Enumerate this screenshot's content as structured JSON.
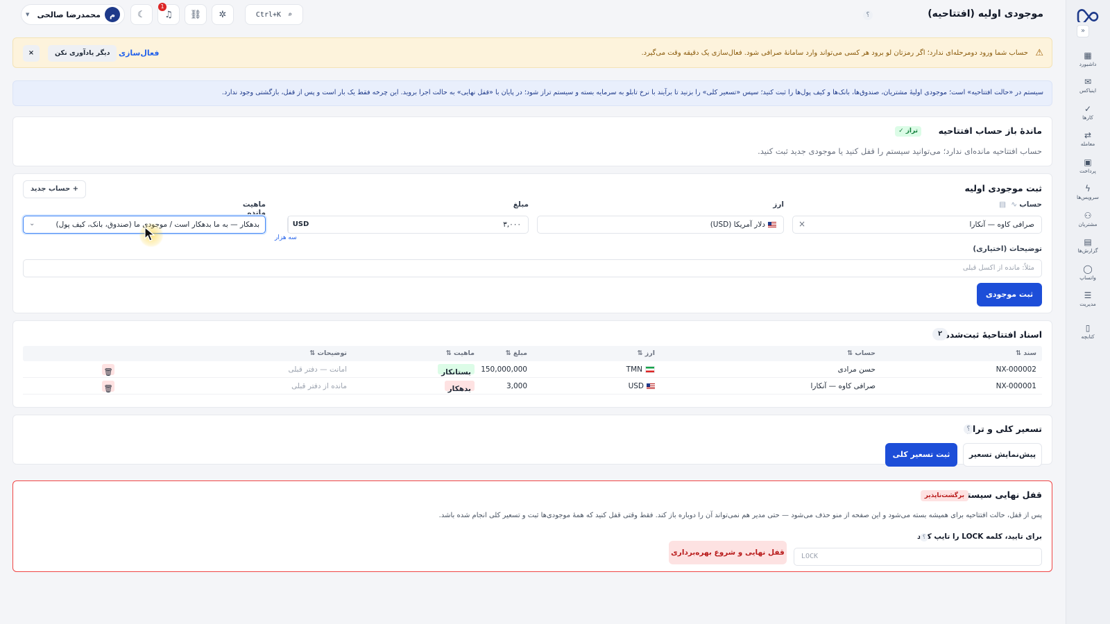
{
  "sidebar": {
    "collapse": "«",
    "items": [
      {
        "label": "داشبورد",
        "icon": "dashboard-icon",
        "glyph": "▦"
      },
      {
        "label": "اینباکس",
        "icon": "inbox-icon",
        "glyph": "✉"
      },
      {
        "label": "کارها",
        "icon": "tasks-icon",
        "glyph": "✓"
      },
      {
        "label": "معامله",
        "icon": "trade-icon",
        "glyph": "⇄"
      },
      {
        "label": "پرداخت",
        "icon": "payment-icon",
        "glyph": "▣"
      },
      {
        "label": "سرویس‌ها",
        "icon": "services-icon",
        "glyph": "ϟ"
      },
      {
        "label": "مشتریان",
        "icon": "customers-icon",
        "glyph": "⚇"
      },
      {
        "label": "گزارش‌ها",
        "icon": "reports-icon",
        "glyph": "▤"
      },
      {
        "label": "واتساپ",
        "icon": "whatsapp-icon",
        "glyph": "◯"
      },
      {
        "label": "مدیریت",
        "icon": "settings-icon",
        "glyph": "☰"
      },
      {
        "label": "کتابچه",
        "icon": "handbook-icon",
        "glyph": "▯"
      }
    ]
  },
  "header": {
    "title": "موجودی اولیه (افتتاحیه)",
    "help": "؟",
    "user_name": "محمدرضا صالحی",
    "user_initial": "م",
    "notifications_count": "1",
    "search_shortcut": "Ctrl+K"
  },
  "warning": {
    "text": "حساب شما ورود دومرحله‌ای ندارد؛ اگر رمزتان لو برود هر کسی می‌تواند وارد سامانهٔ صرافی شود. فعال‌سازی یک دقیقه وقت می‌گیرد.",
    "activate": "فعال‌سازی",
    "dismiss": "دیگر یادآوری نکن",
    "close": "×"
  },
  "info": {
    "text": "سیستم در «حالت افتتاحیه» است؛ موجودی اولیهٔ مشتریان، صندوق‌ها، بانک‌ها و کیف پول‌ها را ثبت کنید؛ سپس «تسعیر کلی» را بزنید تا برآیند با نرخ تابلو به سرمایه بسته و سیستم تراز شود؛ در پایان با «قفل نهایی» به حالت اجرا بروید. این چرخه فقط یک بار است و پس از قفل، بازگشتی وجود ندارد."
  },
  "balance": {
    "title": "ماندهٔ باز حساب افتتاحیه",
    "badge": "تراز ✓",
    "desc": "حساب افتتاحیه مانده‌ای ندارد؛ می‌توانید سیستم را قفل کنید یا موجودی جدید ثبت کنید."
  },
  "form": {
    "title": "ثبت موجودی اولیه",
    "new_account": "+ حساب جدید",
    "account_label": "حساب",
    "account_value": "صرافی کاوه — آنکارا",
    "clear": "×",
    "currency_label": "ارز",
    "currency_value": "دلار آمریکا (USD)",
    "amount_label": "مبلغ",
    "amount_value": "۳,۰۰۰",
    "amount_unit": "USD",
    "amount_words": "سه هزار",
    "nature_label": "ماهیت مانده",
    "nature_value": "بدهکار — به ما بدهکار است / موجودی ما (صندوق، بانک، کیف پول)",
    "notes_label": "توضیحات (اختیاری)",
    "notes_placeholder": "مثلاً: مانده از اکسل قبلی",
    "submit": "ثبت موجودی"
  },
  "docs": {
    "title": "اسناد افتتاحیهٔ ثبت‌شده",
    "count": "۲",
    "columns": {
      "doc": "سند ⇅",
      "account": "حساب ⇅",
      "currency": "ارز ⇅",
      "amount": "مبلغ ⇅",
      "nature": "ماهیت ⇅",
      "notes": "توضیحات ⇅"
    },
    "rows": [
      {
        "doc": "NX-000002",
        "account": "حسن مرادی",
        "currency": "TMN",
        "flag": "iran-flag-icon",
        "amount": "150,000,000",
        "nature": "بستانکار",
        "nature_type": "credit",
        "notes": "امانت — دفتر قبلی"
      },
      {
        "doc": "NX-000001",
        "account": "صرافی کاوه — آنکارا",
        "currency": "USD",
        "flag": "us-flag-icon",
        "amount": "3,000",
        "nature": "بدهکار",
        "nature_type": "debit",
        "notes": "مانده از دفتر قبلی"
      }
    ]
  },
  "revaluation": {
    "title": "تسعیر کلی و تراز",
    "help": "؟",
    "preview": "پیش‌نمایش تسعیر",
    "submit": "ثبت تسعیر کلی"
  },
  "final_lock": {
    "title": "قفل نهایی سیستم",
    "badge": "برگشت‌ناپذیر",
    "desc": "پس از قفل، حالت افتتاحیه برای همیشه بسته می‌شود و این صفحه از منو حذف می‌شود — حتی مدیر هم نمی‌تواند آن را دوباره باز کند. فقط وقتی قفل کنید که همهٔ موجودی‌ها ثبت و تسعیر کلی انجام شده باشد.",
    "confirm_label": "برای تایید، کلمه LOCK را تایپ کنید",
    "help": "؟",
    "input_placeholder": "LOCK",
    "button": "قفل نهایی و شروع بهره‌برداری"
  },
  "colors": {
    "accent": "#1d4ed8",
    "danger": "#dc2626",
    "success": "#15803d",
    "warning_bg": "#fdf3dc",
    "info_bg": "#e9effc"
  }
}
